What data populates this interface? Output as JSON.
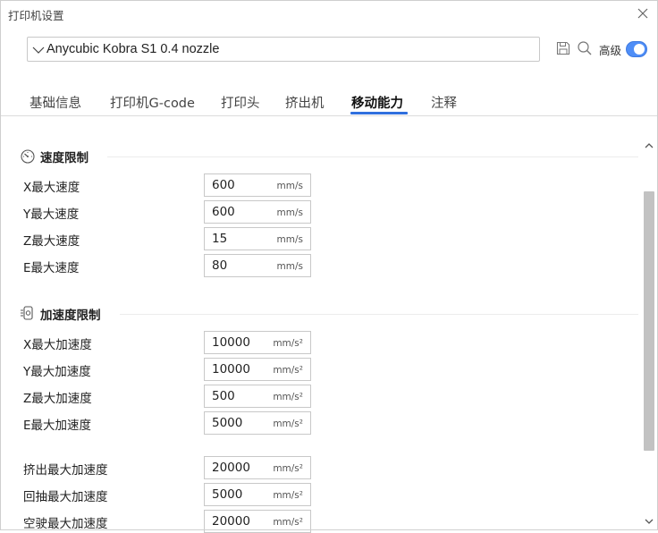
{
  "window": {
    "title": "打印机设置"
  },
  "topbar": {
    "preset": "Anycubic Kobra S1 0.4 nozzle",
    "advanced_label": "高级",
    "advanced_enabled": true
  },
  "tabs": [
    {
      "label": "基础信息",
      "active": false
    },
    {
      "label": "打印机G-code",
      "active": false
    },
    {
      "label": "打印头",
      "active": false
    },
    {
      "label": "挤出机",
      "active": false
    },
    {
      "label": "移动能力",
      "active": true
    },
    {
      "label": "注释",
      "active": false
    }
  ],
  "sections": {
    "speed": {
      "title": "速度限制",
      "rows": [
        {
          "label": "X最大速度",
          "value": "600",
          "unit": "mm/s"
        },
        {
          "label": "Y最大速度",
          "value": "600",
          "unit": "mm/s"
        },
        {
          "label": "Z最大速度",
          "value": "15",
          "unit": "mm/s"
        },
        {
          "label": "E最大速度",
          "value": "80",
          "unit": "mm/s"
        }
      ]
    },
    "accel": {
      "title": "加速度限制",
      "rows": [
        {
          "label": "X最大加速度",
          "value": "10000",
          "unit": "mm/s²"
        },
        {
          "label": "Y最大加速度",
          "value": "10000",
          "unit": "mm/s²"
        },
        {
          "label": "Z最大加速度",
          "value": "500",
          "unit": "mm/s²"
        },
        {
          "label": "E最大加速度",
          "value": "5000",
          "unit": "mm/s²"
        },
        {
          "label": "挤出最大加速度",
          "value": "20000",
          "unit": "mm/s²"
        },
        {
          "label": "回抽最大加速度",
          "value": "5000",
          "unit": "mm/s²"
        },
        {
          "label": "空驶最大加速度",
          "value": "20000",
          "unit": "mm/s²"
        }
      ]
    }
  },
  "colors": {
    "accent": "#2f6fde",
    "toggle": "#4f8ef7",
    "field_border": "#c8c8c8"
  },
  "icons": [
    "close-icon",
    "chevron-down-icon",
    "save-icon",
    "search-icon",
    "speedometer-icon",
    "acceleration-icon",
    "scroll-up-icon",
    "scroll-down-icon"
  ]
}
